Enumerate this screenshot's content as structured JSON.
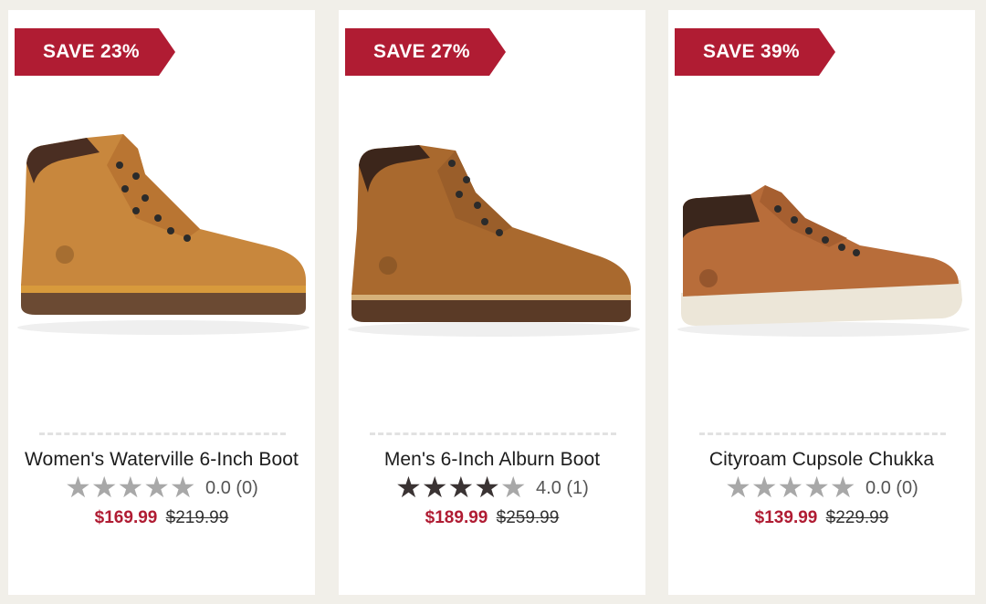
{
  "products": [
    {
      "badge": "SAVE 23%",
      "title": "Women's Waterville 6-Inch Boot",
      "stars_filled": 0,
      "rating_text": "0.0 (0)",
      "sale_price": "$169.99",
      "original_price": "$219.99"
    },
    {
      "badge": "SAVE 27%",
      "title": "Men's 6-Inch Alburn Boot",
      "stars_filled": 4,
      "rating_text": "4.0 (1)",
      "sale_price": "$189.99",
      "original_price": "$259.99"
    },
    {
      "badge": "SAVE 39%",
      "title": "Cityroam Cupsole Chukka",
      "stars_filled": 0,
      "rating_text": "0.0 (0)",
      "sale_price": "$139.99",
      "original_price": "$229.99"
    }
  ],
  "colors": {
    "badge": "#b01c33",
    "sale_price": "#b01c33",
    "star_filled": "#3a3333",
    "star_empty": "#a8a8a8",
    "page_bg": "#f1efe9"
  }
}
